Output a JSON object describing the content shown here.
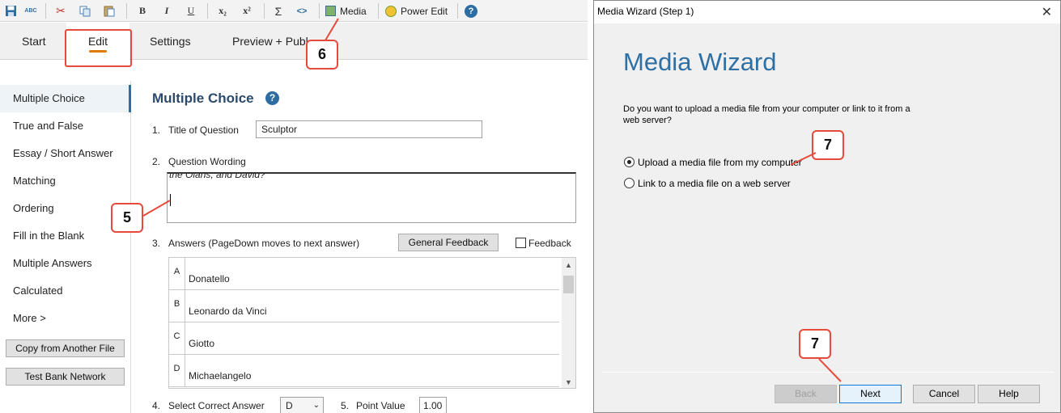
{
  "toolbar": {
    "media_label": "Media",
    "power_edit_label": "Power Edit",
    "bold": "B",
    "italic": "I",
    "underline": "U",
    "subscript": "x₂",
    "superscript": "x²",
    "sigma": "Σ",
    "code": "<>",
    "help": "?",
    "spell": "ABC"
  },
  "tabs": {
    "start": "Start",
    "edit": "Edit",
    "settings": "Settings",
    "preview": "Preview + Publ"
  },
  "sidebar": {
    "items": [
      "Multiple Choice",
      "True and False",
      "Essay / Short Answer",
      "Matching",
      "Ordering",
      "Fill in the Blank",
      "Multiple Answers",
      "Calculated",
      "More >"
    ],
    "copy_button": "Copy from Another File",
    "test_bank_button": "Test Bank Network"
  },
  "main": {
    "heading": "Multiple Choice",
    "help": "?",
    "q1_num": "1.",
    "q1_label": "Title of Question",
    "q1_value": "Sculptor",
    "q2_num": "2.",
    "q2_label": "Question Wording",
    "q2_text_fragment": "the Olans, and David?",
    "q3_num": "3.",
    "q3_label": "Answers  (PageDown moves to next answer)",
    "general_feedback_button": "General Feedback",
    "feedback_label": "Feedback",
    "answers": [
      {
        "letter": "A",
        "text": "Donatello"
      },
      {
        "letter": "B",
        "text": "Leonardo da Vinci"
      },
      {
        "letter": "C",
        "text": "Giotto"
      },
      {
        "letter": "D",
        "text": "Michaelangelo"
      }
    ],
    "q4_num": "4.",
    "q4_label": "Select Correct Answer",
    "q4_value": "D",
    "q5_num": "5.",
    "q5_label": "Point Value",
    "q5_value": "1.00"
  },
  "callouts": {
    "c5": "5",
    "c6": "6",
    "c7a": "7",
    "c7b": "7"
  },
  "dialog": {
    "title": "Media Wizard (Step 1)",
    "close": "✕",
    "heading": "Media Wizard",
    "question": "Do you want to upload a media file from your computer or link to it from a web server?",
    "option_upload": "Upload a media file from my computer",
    "option_link": "Link to a media file on a web server",
    "selected_option": "upload",
    "back": "Back",
    "next": "Next",
    "cancel": "Cancel",
    "help": "Help"
  },
  "colors": {
    "accent_blue": "#2e6fa4",
    "callout_red": "#e64a3a",
    "edit_underline": "#e07b00"
  }
}
